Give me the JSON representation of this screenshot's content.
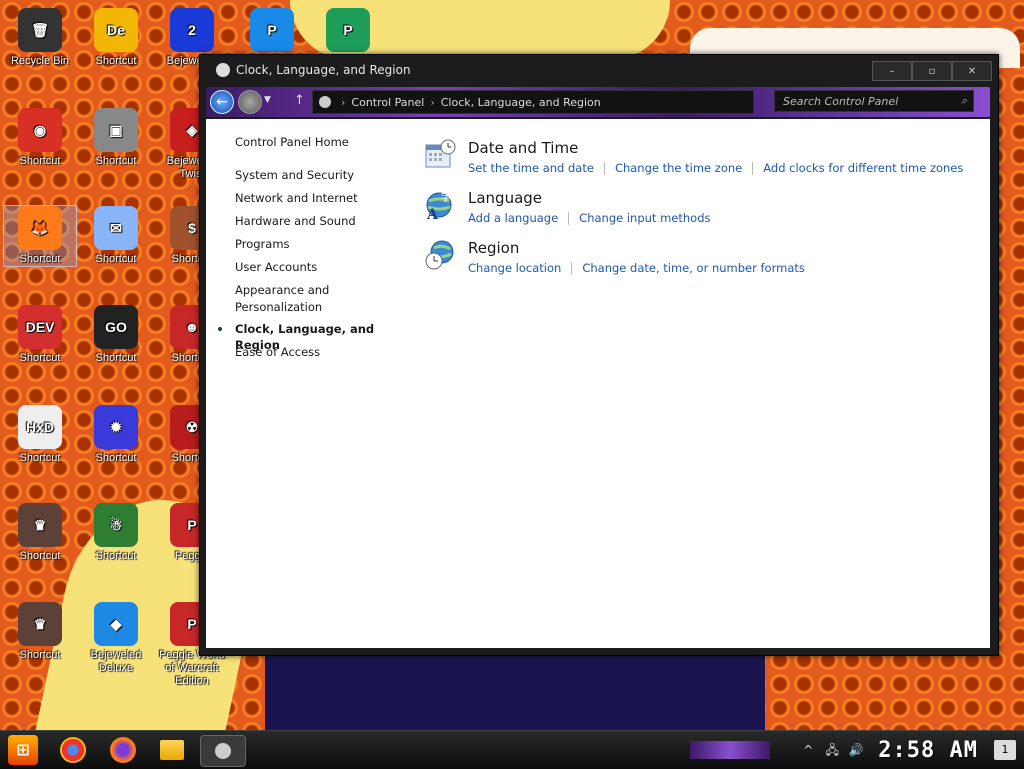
{
  "desktop": {
    "icons": [
      {
        "label": "Recycle Bin",
        "color": "#333333",
        "glyph": "🗑"
      },
      {
        "label": "Shortcut",
        "color": "#f2b705",
        "glyph": "De"
      },
      {
        "label": "Bejeweled",
        "color": "#1a3ad8",
        "glyph": "2"
      },
      {
        "label": "Shortcut",
        "color": "#1a8ae8",
        "glyph": "P"
      },
      {
        "label": "Shortcut",
        "color": "#1f9e5a",
        "glyph": "P"
      },
      {
        "label": "Shortcut",
        "color": "#d93025",
        "glyph": "◉"
      },
      {
        "label": "Shortcut",
        "color": "#888888",
        "glyph": "▣"
      },
      {
        "label": "Bejeweled Twist",
        "color": "#c81e1e",
        "glyph": "◈"
      },
      {
        "label": "Shortcut",
        "color": "#ff7a18",
        "glyph": "🦊"
      },
      {
        "label": "Shortcut",
        "color": "#8ab4f8",
        "glyph": "✉"
      },
      {
        "label": "Shortcut",
        "color": "#a0522d",
        "glyph": "$"
      },
      {
        "label": "Shortcut",
        "color": "#d32f2f",
        "glyph": "DEV"
      },
      {
        "label": "Shortcut",
        "color": "#222222",
        "glyph": "GO"
      },
      {
        "label": "Shortcut",
        "color": "#c62828",
        "glyph": "☻"
      },
      {
        "label": "Shortcut",
        "color": "#eeeeee",
        "glyph": "HxD"
      },
      {
        "label": "Shortcut",
        "color": "#3a3adb",
        "glyph": "✹"
      },
      {
        "label": "Shortcut",
        "color": "#b71c1c",
        "glyph": "☢"
      },
      {
        "label": "Shortcut",
        "color": "#5d4037",
        "glyph": "♛"
      },
      {
        "label": "Shortcut",
        "color": "#2e7d32",
        "glyph": "☃"
      },
      {
        "label": "Peggle",
        "color": "#c62828",
        "glyph": "P"
      },
      {
        "label": "Shortcut",
        "color": "#5d4037",
        "glyph": "♛"
      },
      {
        "label": "Bejeweled Deluxe",
        "color": "#1e88e5",
        "glyph": "◆"
      },
      {
        "label": "Peggle World of Warcraft Edition",
        "color": "#c62828",
        "glyph": "P"
      }
    ]
  },
  "window": {
    "title": "Clock, Language, and Region",
    "controls": {
      "minimize": "–",
      "maximize": "▫",
      "close": "✕"
    },
    "nav": {
      "back_icon": "←",
      "up_icon": "↑",
      "breadcrumb": [
        "Control Panel",
        "Clock, Language, and Region"
      ],
      "separator": "›",
      "search_placeholder": "Search Control Panel",
      "search_icon": "⌕"
    },
    "sidebar": {
      "home": "Control Panel Home",
      "items": [
        "System and Security",
        "Network and Internet",
        "Hardware and Sound",
        "Programs",
        "User Accounts",
        "Appearance and",
        "Personalization",
        "Clock, Language, and Region",
        "Ease of Access"
      ],
      "current_index": 7
    },
    "categories": [
      {
        "title": "Date and Time",
        "icon": "calendar-clock-icon",
        "links": [
          "Set the time and date",
          "Change the time zone",
          "Add clocks for different time zones"
        ]
      },
      {
        "title": "Language",
        "icon": "language-globe-icon",
        "links": [
          "Add a language",
          "Change input methods"
        ]
      },
      {
        "title": "Region",
        "icon": "region-globe-clock-icon",
        "links": [
          "Change location",
          "Change date, time, or number formats"
        ]
      }
    ]
  },
  "taskbar": {
    "start_glyph": "⊞",
    "clock": "2:58 AM",
    "tray": {
      "chevron": "^",
      "network": "🖧",
      "volume": "🔊",
      "notifications": "1"
    }
  },
  "colors": {
    "link": "#1e5aa8",
    "titlebar": "#1c1c1c",
    "navbar_accent": "#7a3fb8"
  }
}
